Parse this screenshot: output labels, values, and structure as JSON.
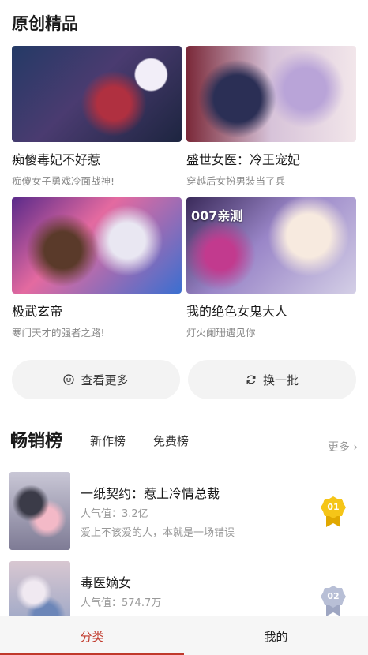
{
  "section": {
    "title": "原创精品"
  },
  "cards": [
    {
      "title": "痴傻毒妃不好惹",
      "subtitle": "痴傻女子勇戏冷面战神!",
      "badge": ""
    },
    {
      "title": "盛世女医：冷王宠妃",
      "subtitle": "穿越后女扮男装当了兵",
      "badge": ""
    },
    {
      "title": "极武玄帝",
      "subtitle": "寒门天才的强者之路!",
      "badge": ""
    },
    {
      "title": "我的绝色女鬼大人",
      "subtitle": "灯火阑珊遇见你",
      "badge": "007亲测"
    }
  ],
  "actions": {
    "more_label": "查看更多",
    "refresh_label": "换一批"
  },
  "ranking": {
    "title": "畅销榜",
    "tabs": [
      "新作榜",
      "免费榜"
    ],
    "more_label": "更多",
    "items": [
      {
        "title": "一纸契约：惹上冷情总裁",
        "popularity": "人气值：3.2亿",
        "desc": "爱上不该爱的人，本就是一场错误",
        "rank": "01",
        "medal_color": "#f5c518"
      },
      {
        "title": "毒医嫡女",
        "popularity": "人气值：574.7万",
        "desc": "",
        "rank": "02",
        "medal_color": "#b8bfd6"
      }
    ]
  },
  "bottom_tabs": {
    "category": "分类",
    "mine": "我的"
  },
  "colors": {
    "accent": "#c0392b",
    "button_bg": "#f3f3f3"
  }
}
